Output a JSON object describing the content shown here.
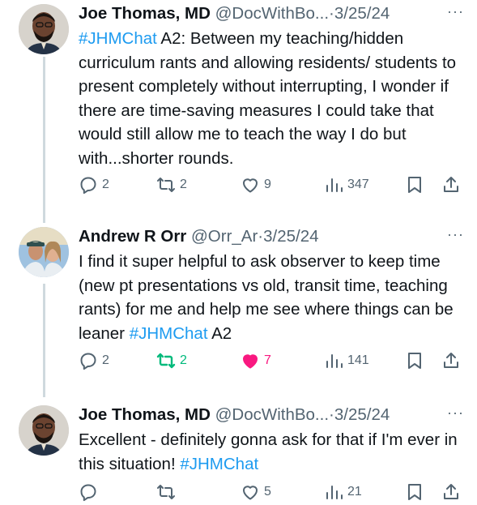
{
  "tweets": [
    {
      "name": "Joe Thomas, MD",
      "handle": "@DocWithBo...",
      "dot": "·",
      "date": "3/25/24",
      "more": "···",
      "hashtag": "#JHMChat",
      "text": " A2: Between my teaching/hidden curriculum rants and allowing residents/ students to present completely without interrupting, I wonder if there are time-saving measures I could take that would still allow me to teach the way I do but with...shorter rounds.",
      "replies": "2",
      "reposts": "2",
      "likes": "9",
      "views": "347"
    },
    {
      "name": "Andrew R Orr",
      "handle": "@Orr_Ar",
      "dot": "·",
      "date": "3/25/24",
      "more": "···",
      "text": "I find it super helpful to ask observer to keep time (new pt presentations vs old, transit time, teaching rants) for me and help me see where things can be leaner ",
      "hashtag": "#JHMChat",
      "text_tail": " A2",
      "replies": "2",
      "reposts": "2",
      "likes": "7",
      "views": "141"
    },
    {
      "name": "Joe Thomas, MD",
      "handle": "@DocWithBo...",
      "dot": "·",
      "date": "3/25/24",
      "more": "···",
      "text": "Excellent - definitely gonna ask for that if I'm ever in this situation! ",
      "hashtag": "#JHMChat",
      "replies": "",
      "reposts": "",
      "likes": "5",
      "views": "21"
    }
  ],
  "colors": {
    "text": "#0f1419",
    "muted": "#536471",
    "link": "#1d9bf0",
    "repost_active": "#00ba7c",
    "like_active": "#f91880",
    "thread_line": "#cfd9de"
  },
  "icons": [
    "reply-icon",
    "repost-icon",
    "like-icon",
    "views-icon",
    "bookmark-icon",
    "share-icon"
  ]
}
